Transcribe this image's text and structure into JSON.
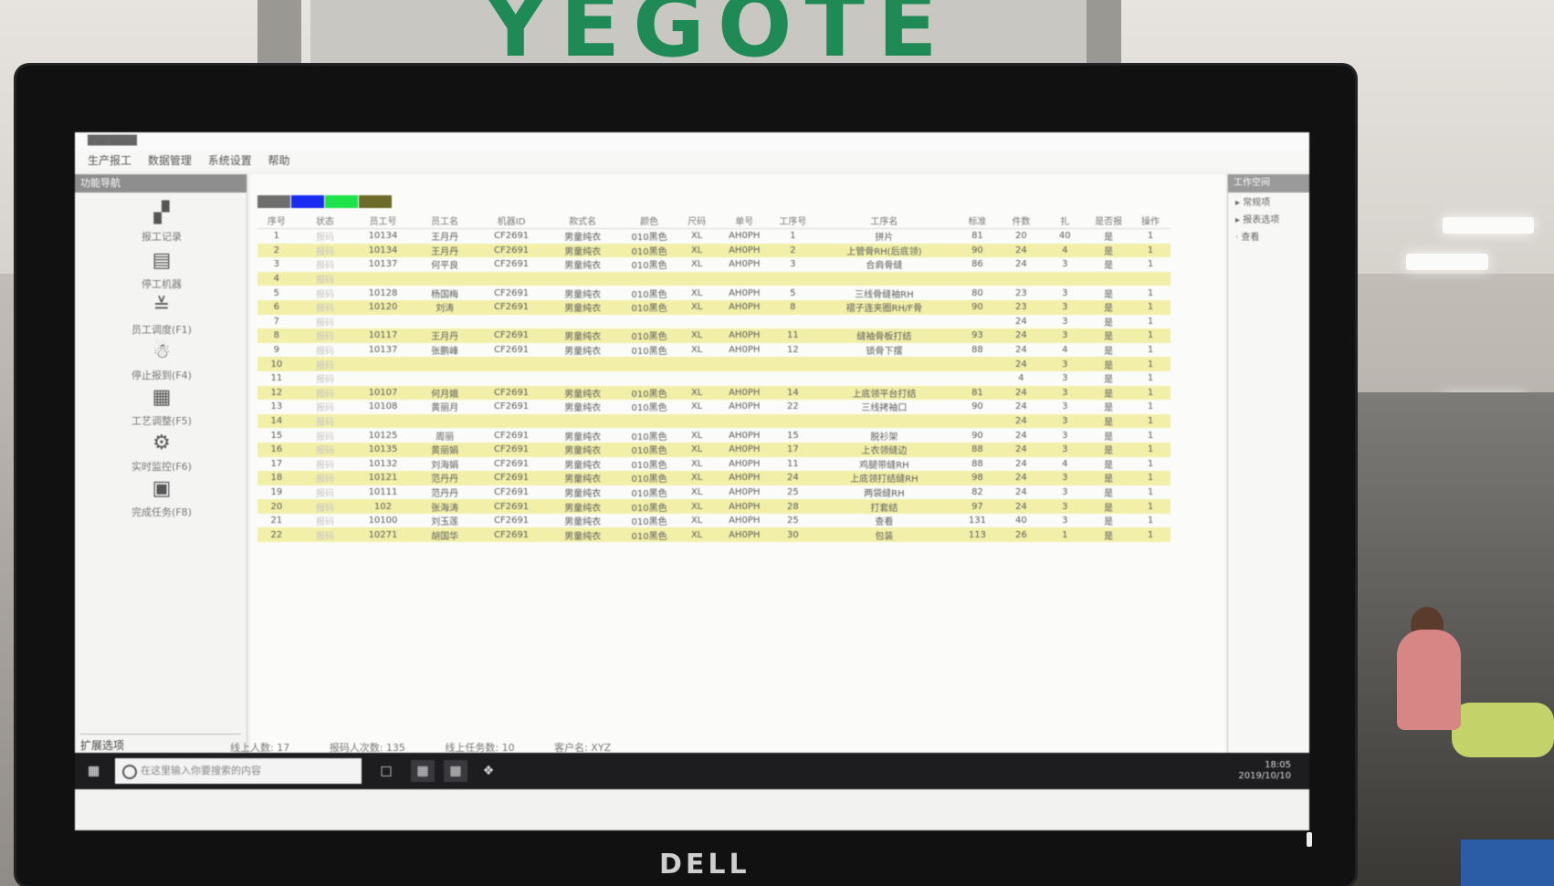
{
  "scene": {
    "sign_text": "YEGOTE",
    "monitor_brand": "DELL"
  },
  "app": {
    "menu": [
      "生产报工",
      "数据管理",
      "系统设置",
      "帮助"
    ],
    "toolbox_title": "功能导航",
    "tools": [
      {
        "label": "报工记录",
        "icon": "document-icon",
        "glyph": "▞"
      },
      {
        "label": "停工机器",
        "icon": "printer-icon",
        "glyph": "▤"
      },
      {
        "label": "员工调度(F1)",
        "icon": "hat-icon",
        "glyph": "≚"
      },
      {
        "label": "停止报到(F4)",
        "icon": "worker-icon",
        "glyph": "☃"
      },
      {
        "label": "工艺调整(F5)",
        "icon": "form-icon",
        "glyph": "▦"
      },
      {
        "label": "实时监控(F6)",
        "icon": "monitor-icon",
        "glyph": "⚙"
      },
      {
        "label": "完成任务(F8)",
        "icon": "box-icon",
        "glyph": "▣"
      }
    ],
    "toolbox_footer": "扩展选项",
    "legend_colors": [
      "#6e6e6e",
      "#1b2cf2",
      "#1ee24a",
      "#6c6b2a"
    ],
    "table": {
      "columns": [
        "序号",
        "状态",
        "员工号",
        "员工名",
        "机器ID",
        "款式名",
        "颜色",
        "尺码",
        "单号",
        "工序号",
        "工序名",
        "标准",
        "件数",
        "扎",
        "是否报",
        "操作"
      ],
      "rows": [
        {
          "c": [
            "1",
            "报码",
            "10134",
            "王月丹",
            "CF2691",
            "男童纯衣",
            "010黑色",
            "XL",
            "AH0PH",
            "1",
            "拼片",
            "81",
            "20",
            "40",
            "是",
            "1"
          ],
          "t": "w"
        },
        {
          "c": [
            "2",
            "报码",
            "10134",
            "王月丹",
            "CF2691",
            "男童纯衣",
            "010黑色",
            "XL",
            "AH0PH",
            "2",
            "上管骨RH(后底领)",
            "90",
            "24",
            "4",
            "是",
            "1"
          ],
          "t": "y"
        },
        {
          "c": [
            "3",
            "报码",
            "10137",
            "何平良",
            "CF2691",
            "男童纯衣",
            "010黑色",
            "XL",
            "AH0PH",
            "3",
            "合肩骨缝",
            "86",
            "24",
            "3",
            "是",
            "1"
          ],
          "t": "w"
        },
        {
          "c": [
            "4",
            "报码",
            "",
            "",
            "",
            "",
            "",
            "",
            "",
            "",
            "",
            "",
            "",
            "",
            "",
            ""
          ],
          "t": "y"
        },
        {
          "c": [
            "5",
            "报码",
            "10128",
            "杨国梅",
            "CF2691",
            "男童纯衣",
            "010黑色",
            "XL",
            "AH0PH",
            "5",
            "三线骨缝袖RH",
            "80",
            "23",
            "3",
            "是",
            "1"
          ],
          "t": "w"
        },
        {
          "c": [
            "6",
            "报码",
            "10120",
            "刘涛",
            "CF2691",
            "男童纯衣",
            "010黑色",
            "XL",
            "AH0PH",
            "8",
            "褶子连夹圈RH/F骨",
            "90",
            "23",
            "3",
            "是",
            "1"
          ],
          "t": "y"
        },
        {
          "c": [
            "7",
            "报码",
            "",
            "",
            "",
            "",
            "",
            "",
            "",
            "",
            "",
            "",
            "24",
            "3",
            "是",
            "1"
          ],
          "t": "w"
        },
        {
          "c": [
            "8",
            "报码",
            "10117",
            "王月丹",
            "CF2691",
            "男童纯衣",
            "010黑色",
            "XL",
            "AH0PH",
            "11",
            "缝袖骨板打结",
            "93",
            "24",
            "3",
            "是",
            "1"
          ],
          "t": "y"
        },
        {
          "c": [
            "9",
            "报码",
            "10137",
            "张鹏峰",
            "CF2691",
            "男童纯衣",
            "010黑色",
            "XL",
            "AH0PH",
            "12",
            "锁骨下摆",
            "88",
            "24",
            "4",
            "是",
            "1"
          ],
          "t": "w"
        },
        {
          "c": [
            "10",
            "报码",
            "",
            "",
            "",
            "",
            "",
            "",
            "",
            "",
            "",
            "",
            "24",
            "3",
            "是",
            "1"
          ],
          "t": "y"
        },
        {
          "c": [
            "11",
            "报码",
            "",
            "",
            "",
            "",
            "",
            "",
            "",
            "",
            "",
            "",
            "4",
            "3",
            "是",
            "1"
          ],
          "t": "w"
        },
        {
          "c": [
            "12",
            "报码",
            "10107",
            "何月娥",
            "CF2691",
            "男童纯衣",
            "010黑色",
            "XL",
            "AH0PH",
            "14",
            "上底领平台打结",
            "81",
            "24",
            "3",
            "是",
            "1"
          ],
          "t": "y"
        },
        {
          "c": [
            "13",
            "报码",
            "10108",
            "黄丽月",
            "CF2691",
            "男童纯衣",
            "010黑色",
            "XL",
            "AH0PH",
            "22",
            "三线拷袖口",
            "90",
            "24",
            "3",
            "是",
            "1"
          ],
          "t": "w"
        },
        {
          "c": [
            "14",
            "报码",
            "",
            "",
            "",
            "",
            "",
            "",
            "",
            "",
            "",
            "",
            "24",
            "3",
            "是",
            "1"
          ],
          "t": "y"
        },
        {
          "c": [
            "15",
            "报码",
            "10125",
            "周丽",
            "CF2691",
            "男童纯衣",
            "010黑色",
            "XL",
            "AH0PH",
            "15",
            "脱衫架",
            "90",
            "24",
            "3",
            "是",
            "1"
          ],
          "t": "w"
        },
        {
          "c": [
            "16",
            "报码",
            "10135",
            "黄丽娟",
            "CF2691",
            "男童纯衣",
            "010黑色",
            "XL",
            "AH0PH",
            "17",
            "上衣领缝边",
            "88",
            "24",
            "3",
            "是",
            "1"
          ],
          "t": "y"
        },
        {
          "c": [
            "17",
            "报码",
            "10132",
            "刘海娟",
            "CF2691",
            "男童纯衣",
            "010黑色",
            "XL",
            "AH0PH",
            "11",
            "鸡腿带缝RH",
            "88",
            "24",
            "4",
            "是",
            "1"
          ],
          "t": "w"
        },
        {
          "c": [
            "18",
            "报码",
            "10121",
            "范丹丹",
            "CF2691",
            "男童纯衣",
            "010黑色",
            "XL",
            "AH0PH",
            "24",
            "上底领打结缝RH",
            "98",
            "24",
            "3",
            "是",
            "1"
          ],
          "t": "y"
        },
        {
          "c": [
            "19",
            "报码",
            "10111",
            "范丹丹",
            "CF2691",
            "男童纯衣",
            "010黑色",
            "XL",
            "AH0PH",
            "25",
            "两袋缝RH",
            "82",
            "24",
            "3",
            "是",
            "1"
          ],
          "t": "w"
        },
        {
          "c": [
            "20",
            "报码",
            "102",
            "张海涛",
            "CF2691",
            "男童纯衣",
            "010黑色",
            "XL",
            "AH0PH",
            "28",
            "打套结",
            "97",
            "24",
            "3",
            "是",
            "1"
          ],
          "t": "y"
        },
        {
          "c": [
            "21",
            "报码",
            "10100",
            "刘玉莲",
            "CF2691",
            "男童纯衣",
            "010黑色",
            "XL",
            "AH0PH",
            "25",
            "查看",
            "131",
            "40",
            "3",
            "是",
            "1"
          ],
          "t": "w"
        },
        {
          "c": [
            "22",
            "报码",
            "10271",
            "胡国华",
            "CF2691",
            "男童纯衣",
            "010黑色",
            "XL",
            "AH0PH",
            "30",
            "包装",
            "113",
            "26",
            "1",
            "是",
            "1"
          ],
          "t": "y"
        }
      ]
    },
    "right_panel": {
      "title": "工作空间",
      "items": [
        "▸ 常规项",
        "▸ 报表选项",
        "  · 查看"
      ]
    },
    "status": [
      "线上人数: 17",
      "报码人次数: 135",
      "线上任务数: 10",
      "客户名: XYZ"
    ],
    "taskbar": {
      "search_placeholder": "在这里输入你要搜索的内容",
      "time": "18:05",
      "date": "2019/10/10"
    }
  }
}
